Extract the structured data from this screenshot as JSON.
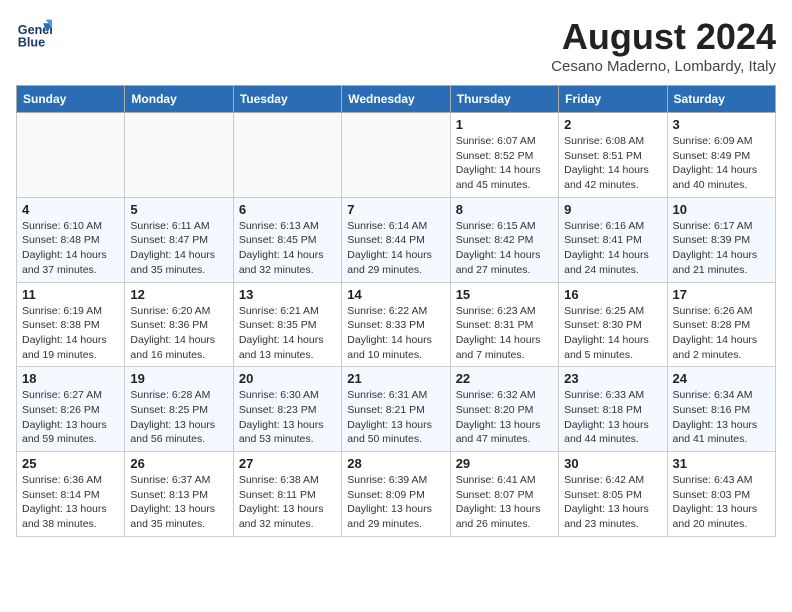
{
  "header": {
    "logo_line1": "General",
    "logo_line2": "Blue",
    "month_year": "August 2024",
    "location": "Cesano Maderno, Lombardy, Italy"
  },
  "weekdays": [
    "Sunday",
    "Monday",
    "Tuesday",
    "Wednesday",
    "Thursday",
    "Friday",
    "Saturday"
  ],
  "weeks": [
    [
      {
        "day": "",
        "info": ""
      },
      {
        "day": "",
        "info": ""
      },
      {
        "day": "",
        "info": ""
      },
      {
        "day": "",
        "info": ""
      },
      {
        "day": "1",
        "info": "Sunrise: 6:07 AM\nSunset: 8:52 PM\nDaylight: 14 hours and 45 minutes."
      },
      {
        "day": "2",
        "info": "Sunrise: 6:08 AM\nSunset: 8:51 PM\nDaylight: 14 hours and 42 minutes."
      },
      {
        "day": "3",
        "info": "Sunrise: 6:09 AM\nSunset: 8:49 PM\nDaylight: 14 hours and 40 minutes."
      }
    ],
    [
      {
        "day": "4",
        "info": "Sunrise: 6:10 AM\nSunset: 8:48 PM\nDaylight: 14 hours and 37 minutes."
      },
      {
        "day": "5",
        "info": "Sunrise: 6:11 AM\nSunset: 8:47 PM\nDaylight: 14 hours and 35 minutes."
      },
      {
        "day": "6",
        "info": "Sunrise: 6:13 AM\nSunset: 8:45 PM\nDaylight: 14 hours and 32 minutes."
      },
      {
        "day": "7",
        "info": "Sunrise: 6:14 AM\nSunset: 8:44 PM\nDaylight: 14 hours and 29 minutes."
      },
      {
        "day": "8",
        "info": "Sunrise: 6:15 AM\nSunset: 8:42 PM\nDaylight: 14 hours and 27 minutes."
      },
      {
        "day": "9",
        "info": "Sunrise: 6:16 AM\nSunset: 8:41 PM\nDaylight: 14 hours and 24 minutes."
      },
      {
        "day": "10",
        "info": "Sunrise: 6:17 AM\nSunset: 8:39 PM\nDaylight: 14 hours and 21 minutes."
      }
    ],
    [
      {
        "day": "11",
        "info": "Sunrise: 6:19 AM\nSunset: 8:38 PM\nDaylight: 14 hours and 19 minutes."
      },
      {
        "day": "12",
        "info": "Sunrise: 6:20 AM\nSunset: 8:36 PM\nDaylight: 14 hours and 16 minutes."
      },
      {
        "day": "13",
        "info": "Sunrise: 6:21 AM\nSunset: 8:35 PM\nDaylight: 14 hours and 13 minutes."
      },
      {
        "day": "14",
        "info": "Sunrise: 6:22 AM\nSunset: 8:33 PM\nDaylight: 14 hours and 10 minutes."
      },
      {
        "day": "15",
        "info": "Sunrise: 6:23 AM\nSunset: 8:31 PM\nDaylight: 14 hours and 7 minutes."
      },
      {
        "day": "16",
        "info": "Sunrise: 6:25 AM\nSunset: 8:30 PM\nDaylight: 14 hours and 5 minutes."
      },
      {
        "day": "17",
        "info": "Sunrise: 6:26 AM\nSunset: 8:28 PM\nDaylight: 14 hours and 2 minutes."
      }
    ],
    [
      {
        "day": "18",
        "info": "Sunrise: 6:27 AM\nSunset: 8:26 PM\nDaylight: 13 hours and 59 minutes."
      },
      {
        "day": "19",
        "info": "Sunrise: 6:28 AM\nSunset: 8:25 PM\nDaylight: 13 hours and 56 minutes."
      },
      {
        "day": "20",
        "info": "Sunrise: 6:30 AM\nSunset: 8:23 PM\nDaylight: 13 hours and 53 minutes."
      },
      {
        "day": "21",
        "info": "Sunrise: 6:31 AM\nSunset: 8:21 PM\nDaylight: 13 hours and 50 minutes."
      },
      {
        "day": "22",
        "info": "Sunrise: 6:32 AM\nSunset: 8:20 PM\nDaylight: 13 hours and 47 minutes."
      },
      {
        "day": "23",
        "info": "Sunrise: 6:33 AM\nSunset: 8:18 PM\nDaylight: 13 hours and 44 minutes."
      },
      {
        "day": "24",
        "info": "Sunrise: 6:34 AM\nSunset: 8:16 PM\nDaylight: 13 hours and 41 minutes."
      }
    ],
    [
      {
        "day": "25",
        "info": "Sunrise: 6:36 AM\nSunset: 8:14 PM\nDaylight: 13 hours and 38 minutes."
      },
      {
        "day": "26",
        "info": "Sunrise: 6:37 AM\nSunset: 8:13 PM\nDaylight: 13 hours and 35 minutes."
      },
      {
        "day": "27",
        "info": "Sunrise: 6:38 AM\nSunset: 8:11 PM\nDaylight: 13 hours and 32 minutes."
      },
      {
        "day": "28",
        "info": "Sunrise: 6:39 AM\nSunset: 8:09 PM\nDaylight: 13 hours and 29 minutes."
      },
      {
        "day": "29",
        "info": "Sunrise: 6:41 AM\nSunset: 8:07 PM\nDaylight: 13 hours and 26 minutes."
      },
      {
        "day": "30",
        "info": "Sunrise: 6:42 AM\nSunset: 8:05 PM\nDaylight: 13 hours and 23 minutes."
      },
      {
        "day": "31",
        "info": "Sunrise: 6:43 AM\nSunset: 8:03 PM\nDaylight: 13 hours and 20 minutes."
      }
    ]
  ]
}
